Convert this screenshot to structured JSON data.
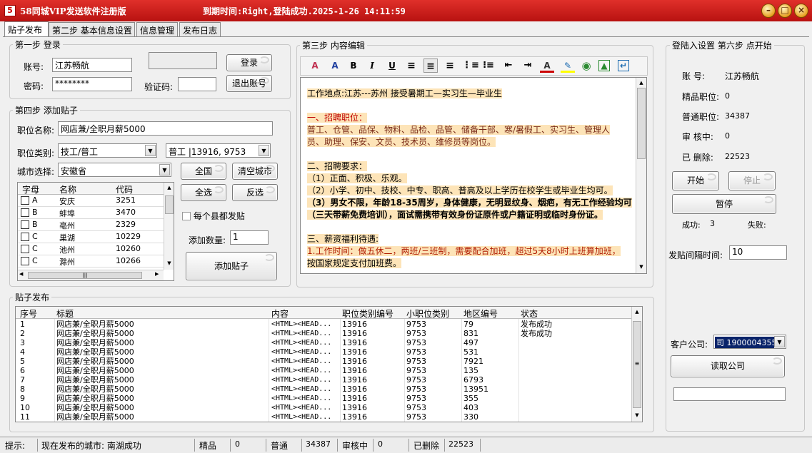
{
  "window": {
    "title": "58同城VIP发送软件注册版",
    "expire": "到期时间:Right,登陆成功.2025-1-26 14:11:59"
  },
  "tabs": [
    "贴子发布",
    "第二步 基本信息设置",
    "信息管理",
    "发布日志"
  ],
  "login": {
    "group": "第一步 登录",
    "account_label": "账号:",
    "account": "江苏畅航",
    "password_label": "密码:",
    "password": "********",
    "captcha_label": "验证码:",
    "login_btn": "登录",
    "logout_btn": "退出账号"
  },
  "add_post": {
    "group": "第四步 添加贴子",
    "job_name_label": "职位名称:",
    "job_name": "网店兼/全职月薪5000",
    "job_type_label": "职位类别:",
    "job_type": "技工/普工",
    "job_sub": "普工 |13916, 9753",
    "city_label": "城市选择:",
    "province": "安徽省",
    "btn_all_country": "全国",
    "btn_clear_city": "清空城市",
    "btn_select_all": "全选",
    "btn_invert": "反选",
    "each_county_label": "每个县都发贴",
    "count_label": "添加数量:",
    "count": "1",
    "btn_add": "添加贴子",
    "city_headers": [
      "字母",
      "名称",
      "代码"
    ],
    "cities": [
      {
        "letter": "A",
        "name": "安庆",
        "code": "3251"
      },
      {
        "letter": "B",
        "name": "蚌埠",
        "code": "3470"
      },
      {
        "letter": "B",
        "name": "亳州",
        "code": "2329"
      },
      {
        "letter": "C",
        "name": "巢湖",
        "code": "10229"
      },
      {
        "letter": "C",
        "name": "池州",
        "code": "10260"
      },
      {
        "letter": "C",
        "name": "滁州",
        "code": "10266"
      }
    ]
  },
  "content": {
    "group": "第三步 内容编辑",
    "lines": [
      {
        "text": "工作地点:江苏---苏州  接受暑期工—实习生—毕业生",
        "cls": "hl"
      },
      {
        "text": "",
        "cls": ""
      },
      {
        "text": "一、招聘职位：",
        "cls": "hl red"
      },
      {
        "text": "普工、仓管、品保、物料、品检、品管、储备干部、寒/暑假工、实习生、管理人",
        "cls": "hl brown"
      },
      {
        "text": "员、助理、保安、文员、技术员、维修员等岗位。",
        "cls": "hl brown"
      },
      {
        "text": "",
        "cls": ""
      },
      {
        "text": "二、招聘要求：",
        "cls": "hl"
      },
      {
        "text": "（1）正面、积极、乐观。",
        "cls": "hl"
      },
      {
        "text": "（2）小学、初中、技校、中专、职高、普高及以上学历在校学生或毕业生均可。",
        "cls": "hl"
      },
      {
        "text": "（3）男女不限，年龄18-35周岁，身体健康，无明显纹身、烟疤，有无工作经验均可",
        "cls": "hl b"
      },
      {
        "text": "（三天带薪免费培训），面试需携带有效身份证原件或户籍证明或临时身份证。",
        "cls": "hl b"
      },
      {
        "text": "",
        "cls": ""
      },
      {
        "text": "三、薪资福利待遇:",
        "cls": "hl"
      },
      {
        "text": "1.工作时间：做五休二，两班/三班制，需要配合加班，超过5天8小时上班算加班，",
        "cls": "hl mix"
      },
      {
        "text": "按国家规定支付加班费。",
        "cls": "hl"
      }
    ]
  },
  "side": {
    "group": "登陆入设置 第六步  点开始",
    "account_label": "账      号:",
    "account": "江苏畅航",
    "premium_label": "精品职位:",
    "premium": "0",
    "normal_label": "普通职位:",
    "normal": "34387",
    "review_label": "审   核中:",
    "review": "0",
    "deleted_label": "已   删除:",
    "deleted": "22523",
    "btn_start": "开始",
    "btn_stop": "停止",
    "btn_pause": "暂停",
    "success_label": "成功:",
    "success": "3",
    "fail_label": "失败:",
    "interval_label": "发贴间隔时间:",
    "interval": "10",
    "company_label": "客户公司:",
    "company": "司 190000435552",
    "btn_read_company": "读取公司"
  },
  "posts": {
    "group": "贴子发布",
    "headers": [
      "序号",
      "标题",
      "内容",
      "职位类别编号",
      "小职位类别",
      "地区编号",
      "状态"
    ],
    "rows": [
      {
        "no": "1",
        "title": "网店兼/全职月薪5000",
        "content": "<HTML><HEAD...",
        "cat": "13916",
        "sub": "9753",
        "area": "79",
        "status": "发布成功"
      },
      {
        "no": "2",
        "title": "网店兼/全职月薪5000",
        "content": "<HTML><HEAD...",
        "cat": "13916",
        "sub": "9753",
        "area": "831",
        "status": "发布成功"
      },
      {
        "no": "3",
        "title": "网店兼/全职月薪5000",
        "content": "<HTML><HEAD...",
        "cat": "13916",
        "sub": "9753",
        "area": "497",
        "status": ""
      },
      {
        "no": "4",
        "title": "网店兼/全职月薪5000",
        "content": "<HTML><HEAD...",
        "cat": "13916",
        "sub": "9753",
        "area": "531",
        "status": ""
      },
      {
        "no": "5",
        "title": "网店兼/全职月薪5000",
        "content": "<HTML><HEAD...",
        "cat": "13916",
        "sub": "9753",
        "area": "7921",
        "status": ""
      },
      {
        "no": "6",
        "title": "网店兼/全职月薪5000",
        "content": "<HTML><HEAD...",
        "cat": "13916",
        "sub": "9753",
        "area": "135",
        "status": ""
      },
      {
        "no": "7",
        "title": "网店兼/全职月薪5000",
        "content": "<HTML><HEAD...",
        "cat": "13916",
        "sub": "9753",
        "area": "6793",
        "status": ""
      },
      {
        "no": "8",
        "title": "网店兼/全职月薪5000",
        "content": "<HTML><HEAD...",
        "cat": "13916",
        "sub": "9753",
        "area": "13951",
        "status": ""
      },
      {
        "no": "9",
        "title": "网店兼/全职月薪5000",
        "content": "<HTML><HEAD...",
        "cat": "13916",
        "sub": "9753",
        "area": "355",
        "status": ""
      },
      {
        "no": "10",
        "title": "网店兼/全职月薪5000",
        "content": "<HTML><HEAD...",
        "cat": "13916",
        "sub": "9753",
        "area": "403",
        "status": ""
      },
      {
        "no": "11",
        "title": "网店兼/全职月薪5000",
        "content": "<HTML><HEAD...",
        "cat": "13916",
        "sub": "9753",
        "area": "330",
        "status": ""
      }
    ]
  },
  "status": {
    "hint_label": "提示:",
    "hint": "现在发布的城市: 南湖成功",
    "premium_label": "精品",
    "premium": "0",
    "normal_label": "普通",
    "normal": "34387",
    "review_label": "审核中",
    "review": "0",
    "deleted_label": "已删除",
    "deleted": "22523"
  }
}
